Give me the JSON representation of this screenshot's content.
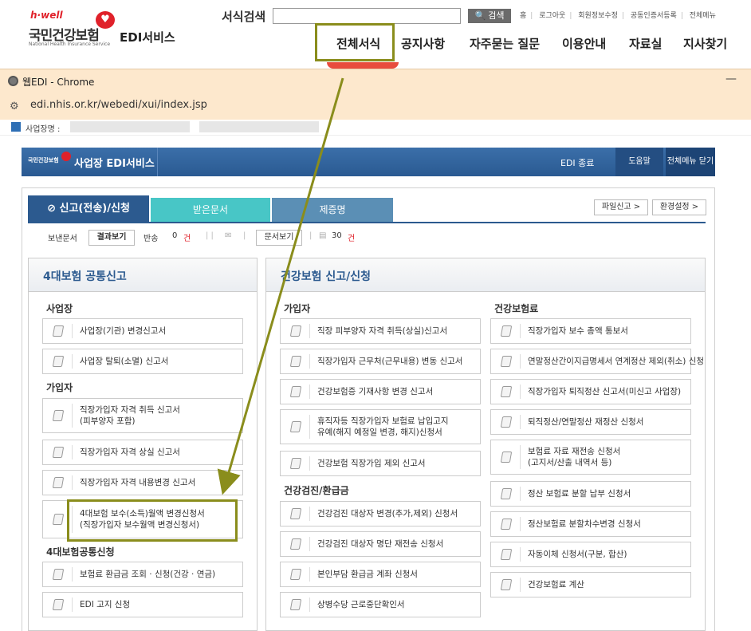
{
  "site": {
    "logo_hwell": "h·well",
    "logo_name": "국민건강보험",
    "logo_en": "National Health Insurance Service",
    "service_title": "EDI서비스",
    "search_label": "서식검색",
    "search_placeholder": "",
    "search_button": "검색",
    "util_links": [
      "홈",
      "로그아웃",
      "회원정보수정",
      "공동인증서등록",
      "전체메뉴"
    ],
    "nav": [
      "전체서식",
      "공지사항",
      "자주묻는 질문",
      "이용안내",
      "자료실",
      "지사찾기"
    ]
  },
  "chrome": {
    "title": "웹EDI - Chrome",
    "minimize": "—",
    "url": "edi.nhis.or.kr/webedi/xui/index.jsp",
    "bizname_label": "사업장명 :"
  },
  "app": {
    "logo": "국민건강보험",
    "title": "사업장 EDI서비스",
    "exit": "EDI 종료",
    "help": "도움말",
    "close_menu": "전체메뉴 닫기"
  },
  "tabs": {
    "report": "신고(전송)/신청",
    "received": "받은문서",
    "certificate": "제증명",
    "file_report": "파일신고 >",
    "settings": "환경설정 >"
  },
  "status": {
    "sent_label": "보낸문서",
    "result_button": "결과보기",
    "return_label": "반송",
    "return_count": "0",
    "unit1": "건",
    "doc_view_button": "문서보기",
    "doc_count": "30",
    "unit2": "건"
  },
  "common": {
    "title": "4대보험 공통신고",
    "groups": [
      {
        "title": "사업장",
        "items": [
          "사업장(기관) 변경신고서",
          "사업장 탈퇴(소멸) 신고서"
        ]
      },
      {
        "title": "가입자",
        "items": [
          "직장가입자 자격 취득 신고서\n(피부양자 포함)",
          "직장가입자 자격 상실 신고서",
          "직장가입자 자격 내용변경 신고서",
          "4대보험 보수(소득)월액 변경신청서\n(직장가입자 보수월액 변경신청서)"
        ]
      },
      {
        "title": "4대보험공통신청",
        "items": [
          "보험료 환급금 조회 · 신청(건강 · 연금)",
          "EDI 고지 신청"
        ]
      }
    ]
  },
  "health": {
    "title": "건강보험 신고/신청",
    "col1_groups": [
      {
        "title": "가입자",
        "items": [
          "직장 피부양자 자격 취득(상실)신고서",
          "직장가입자 근무처(근무내용) 변동 신고서",
          "건강보험증 기재사항 변경 신고서",
          "휴직자등 직장가입자 보험료 납입고지\n유예(해지 예정일 변경, 해지)신청서",
          "건강보험 직장가입 제외 신고서"
        ]
      },
      {
        "title": "건강검진/환급금",
        "items": [
          "건강검진 대상자 변경(추가,제외) 신청서",
          "건강검진 대상자 명단 재전송 신청서",
          "본인부담 환급금 계좌 신청서",
          "상병수당 근로중단확인서"
        ]
      }
    ],
    "col2_groups": [
      {
        "title": "건강보험료",
        "items": [
          "직장가입자 보수 총액 통보서",
          "연말정산간이지급명세서 연계정산 제외(취소) 신청",
          "직장가입자 퇴직정산 신고서(미신고 사업장)",
          "퇴직정산/연말정산 재정산 신청서",
          "보험료 자료 재전송 신청서\n(고지서/산출 내역서 등)",
          "정산 보험료 분할 납부 신청서",
          "정산보험료 분할차수변경 신청서",
          "자동이체 신청서(구분, 합산)",
          "건강보험료 계산"
        ]
      }
    ]
  }
}
